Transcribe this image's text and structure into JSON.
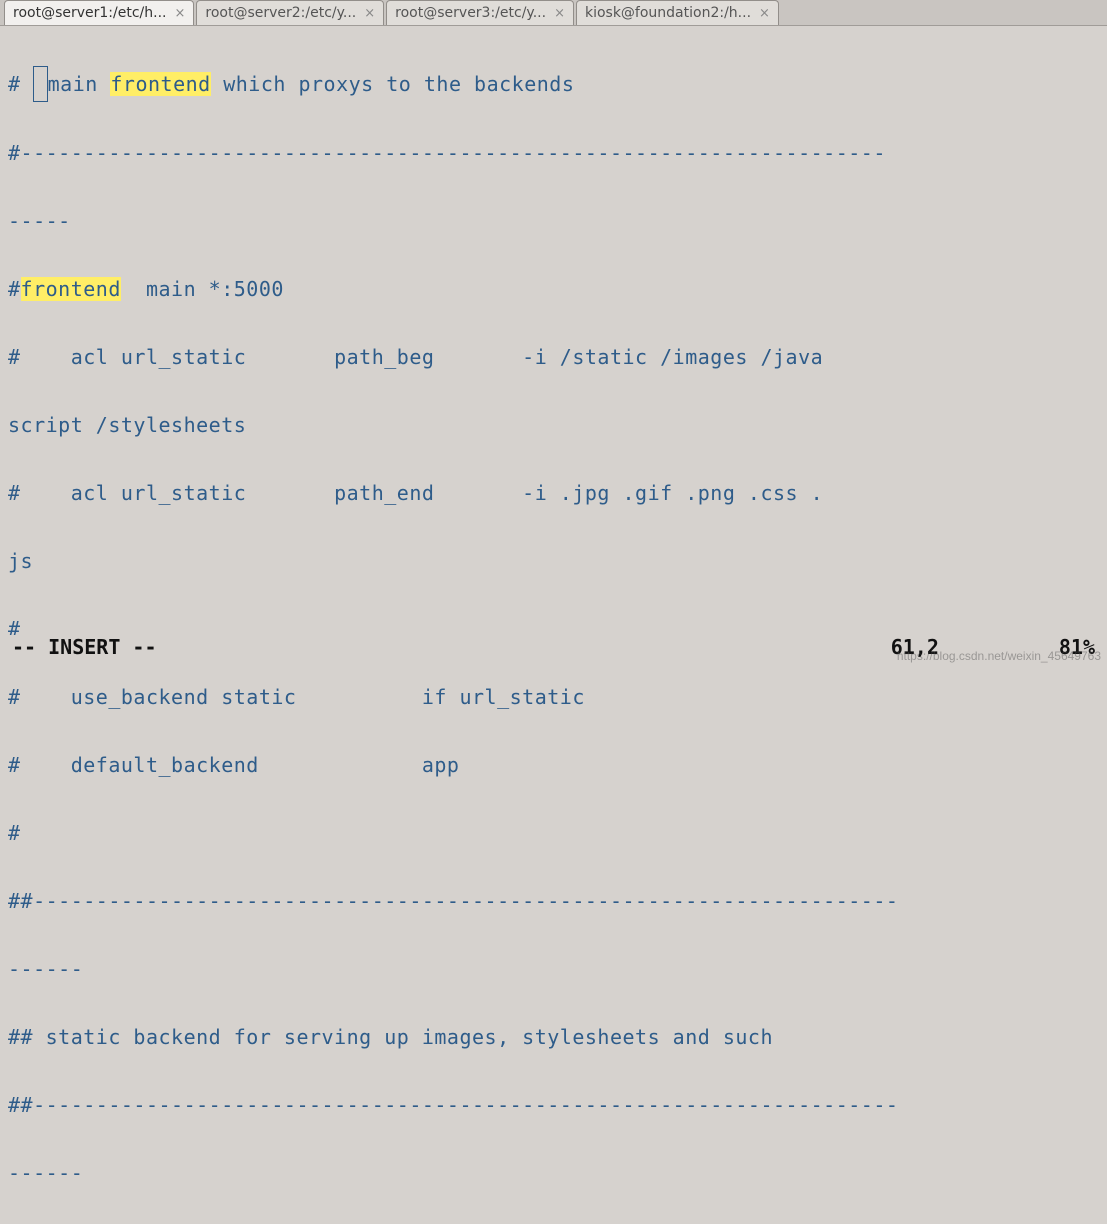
{
  "tabs": {
    "t0": {
      "label": "root@server1:/etc/h...",
      "close": "×"
    },
    "t1": {
      "label": "root@server2:/etc/y...",
      "close": "×"
    },
    "t2": {
      "label": "root@server3:/etc/y...",
      "close": "×"
    },
    "t3": {
      "label": "kiosk@foundation2:/h...",
      "close": "×"
    }
  },
  "editor": {
    "cursor_char": " ",
    "l1_a": "# ",
    "l1_b": "main ",
    "l1_hl1": "frontend",
    "l1_c": " which proxys to the backends",
    "l2": "#---------------------------------------------------------------------",
    "l3": "-----",
    "l4_a": "#",
    "l4_hl": "frontend",
    "l4_b": "  main *:5000",
    "l5": "#    acl url_static       path_beg       -i /static /images /java",
    "l6": "script /stylesheets",
    "l7": "#    acl url_static       path_end       -i .jpg .gif .png .css .",
    "l8": "js",
    "l9": "#",
    "l10": "#    use_backend static          if url_static",
    "l11": "#    default_backend             app",
    "l12": "#",
    "l13": "##---------------------------------------------------------------------",
    "l14": "------",
    "l15": "## static backend for serving up images, stylesheets and such",
    "l16": "##---------------------------------------------------------------------",
    "l17": "------"
  },
  "status": {
    "mode": "-- INSERT --",
    "pos": "61,2",
    "pct": "81%"
  },
  "watermark": "https://blog.csdn.net/weixin_45649763"
}
